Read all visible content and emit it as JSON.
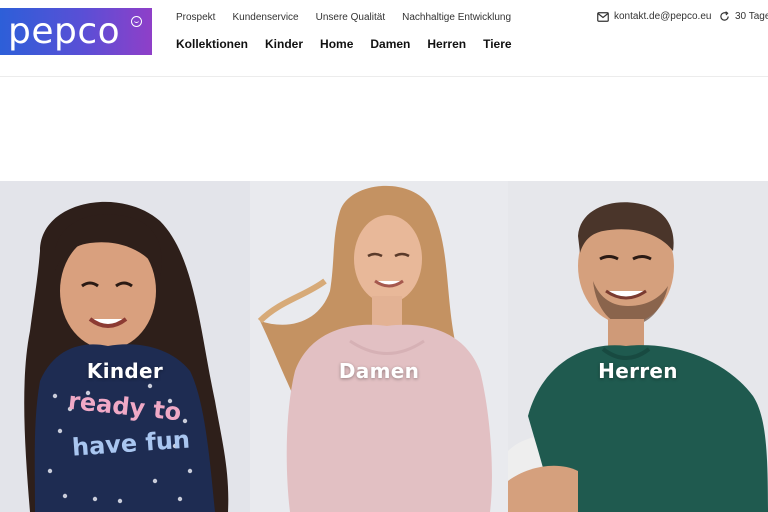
{
  "brand": {
    "name": "pepco",
    "colors": {
      "gradient_start": "#2d5fd8",
      "gradient_end": "#8f3fc8"
    }
  },
  "topnav": [
    "Prospekt",
    "Kundenservice",
    "Unsere Qualität",
    "Nachhaltige Entwicklung"
  ],
  "mainnav": [
    "Kollektionen",
    "Kinder",
    "Home",
    "Damen",
    "Herren",
    "Tiere"
  ],
  "contact": {
    "icon": "mail-icon",
    "email": "kontakt.de@pepco.eu"
  },
  "returns": {
    "icon": "refresh-icon",
    "label": "30 Tage"
  },
  "categories": [
    {
      "label": "Kinder",
      "shirt_text_1": "ready to",
      "shirt_text_2": "have fun"
    },
    {
      "label": "Damen"
    },
    {
      "label": "Herren"
    }
  ]
}
